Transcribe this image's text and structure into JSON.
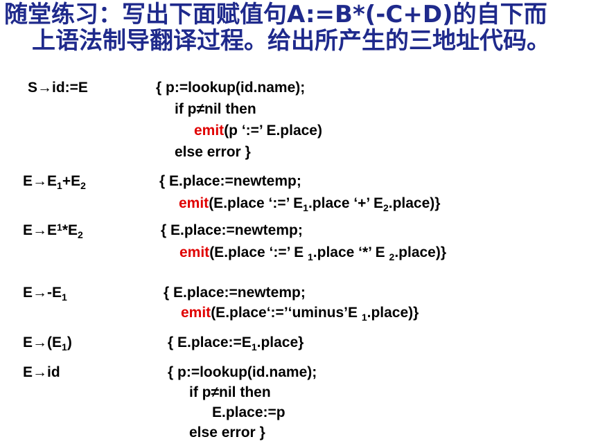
{
  "title": {
    "line1": "随堂练习：写出下面赋值句A:=B*(-C+D)的自下而",
    "line2": "上语法制导翻译过程。给出所产生的三地址代码。"
  },
  "sym": {
    "emit": "emit",
    "one": "1",
    "two": "2"
  },
  "rules": {
    "r1": {
      "prod": "S→id:=E",
      "a1": "{  p:=lookup(id.name);",
      "a2": "if p≠nil then",
      "a3": "(p ‘:=’ E.place)",
      "a4": "else error  }"
    },
    "r2": {
      "prod_a": "E→E",
      "prod_b": "+E",
      "a1": "{  E.place:=newtemp;",
      "a2_a": "(E.place ‘:=’ E",
      "a2_b": ".place ‘+’ E",
      "a2_c": ".place)}"
    },
    "r3": {
      "prod_a": "E→E",
      "prod_b": "*E",
      "a1": "{  E.place:=newtemp;",
      "a2_a": "(E.place ‘:=’ E ",
      "a2_b": ".place ‘*’ E ",
      "a2_c": ".place)}"
    },
    "r4": {
      "prod_a": "E→-E",
      "a1": "{  E.place:=newtemp;",
      "a2_a": "(E.place‘:=’‘uminus’E ",
      "a2_b": ".place)}"
    },
    "r5": {
      "prod_a": "E→(E",
      "prod_b": ")",
      "a1_a": "{  E.place:=E",
      "a1_b": ".place}"
    },
    "r6": {
      "prod": "E→id",
      "a1": "{   p:=lookup(id.name);",
      "a2": "if p≠nil then",
      "a3": "E.place:=p",
      "a4": "else error }"
    }
  }
}
